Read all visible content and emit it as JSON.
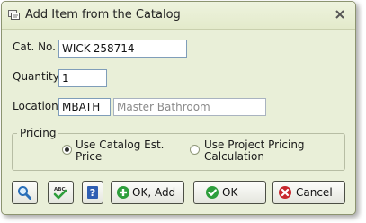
{
  "window": {
    "title": "Add Item from the Catalog"
  },
  "form": {
    "cat_no": {
      "label": "Cat. No.",
      "value": "WICK-258714"
    },
    "quantity": {
      "label": "Quantity",
      "value": "1"
    },
    "location": {
      "label": "Location",
      "code": "MBATH",
      "name": "Master Bathroom"
    }
  },
  "pricing": {
    "group_label": "Pricing",
    "options": [
      {
        "line1": "Use Catalog Est.",
        "line2": "Price",
        "selected": true
      },
      {
        "line1": "Use Project Pricing",
        "line2": "Calculation",
        "selected": false
      }
    ]
  },
  "buttons": {
    "search_icon": "magnifier-icon",
    "spellcheck_icon": "abc-check-icon",
    "help_icon": "question-icon",
    "ok_add": "OK, Add",
    "ok": "OK",
    "cancel": "Cancel"
  },
  "colors": {
    "dialog_background": "#e9efd8",
    "ok_add_icon": "#2e9e3c",
    "ok_icon": "#2e9e3c",
    "cancel_icon": "#c8282d",
    "help_icon": "#2f5fb3"
  }
}
